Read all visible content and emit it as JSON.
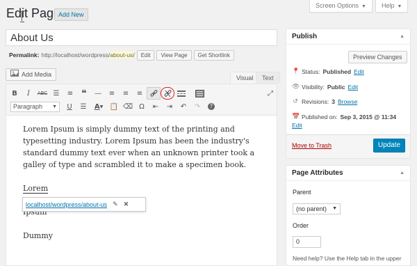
{
  "header": {
    "title": "Edit Page",
    "add_new": "Add New",
    "screen_options": "Screen Options",
    "help": "Help"
  },
  "post": {
    "title": "About Us",
    "permalink_label": "Permalink:",
    "permalink_base": "http://localhost/wordpress/",
    "permalink_slug": "about-us",
    "permalink_end": "/",
    "edit_btn": "Edit",
    "view_page_btn": "View Page",
    "shortlink_btn": "Get Shortlink"
  },
  "editor": {
    "add_media": "Add Media",
    "tab_visual": "Visual",
    "tab_text": "Text",
    "format_select": "Paragraph",
    "paragraph1": "Lorem Ipsum is simply dummy text of the printing and typesetting industry. Lorem Ipsum has been the industry's standard dummy text ever when an unknown printer took a galley of type and scrambled it to make a specimen book.",
    "linked_word": "Lorem",
    "word2": "Ipsum",
    "word3": "Dummy",
    "link_url": "localhost/wordpress/about-us"
  },
  "publish": {
    "title": "Publish",
    "preview_btn": "Preview Changes",
    "status_label": "Status:",
    "status_value": "Published",
    "status_edit": "Edit",
    "visibility_label": "Visibility:",
    "visibility_value": "Public",
    "visibility_edit": "Edit",
    "revisions_label": "Revisions:",
    "revisions_value": "3",
    "revisions_browse": "Browse",
    "published_label": "Published on:",
    "published_value": "Sep 3, 2015 @ 11:34",
    "published_edit": "Edit",
    "trash": "Move to Trash",
    "update": "Update"
  },
  "page_attributes": {
    "title": "Page Attributes",
    "parent_label": "Parent",
    "parent_value": "(no parent)",
    "order_label": "Order",
    "order_value": "0",
    "help_text": "Need help? Use the Help tab in the upper"
  },
  "colors": {
    "accent": "#0073aa",
    "update_button": "#0085ba",
    "trash": "#a00000",
    "highlight_ring": "#dd2222"
  }
}
